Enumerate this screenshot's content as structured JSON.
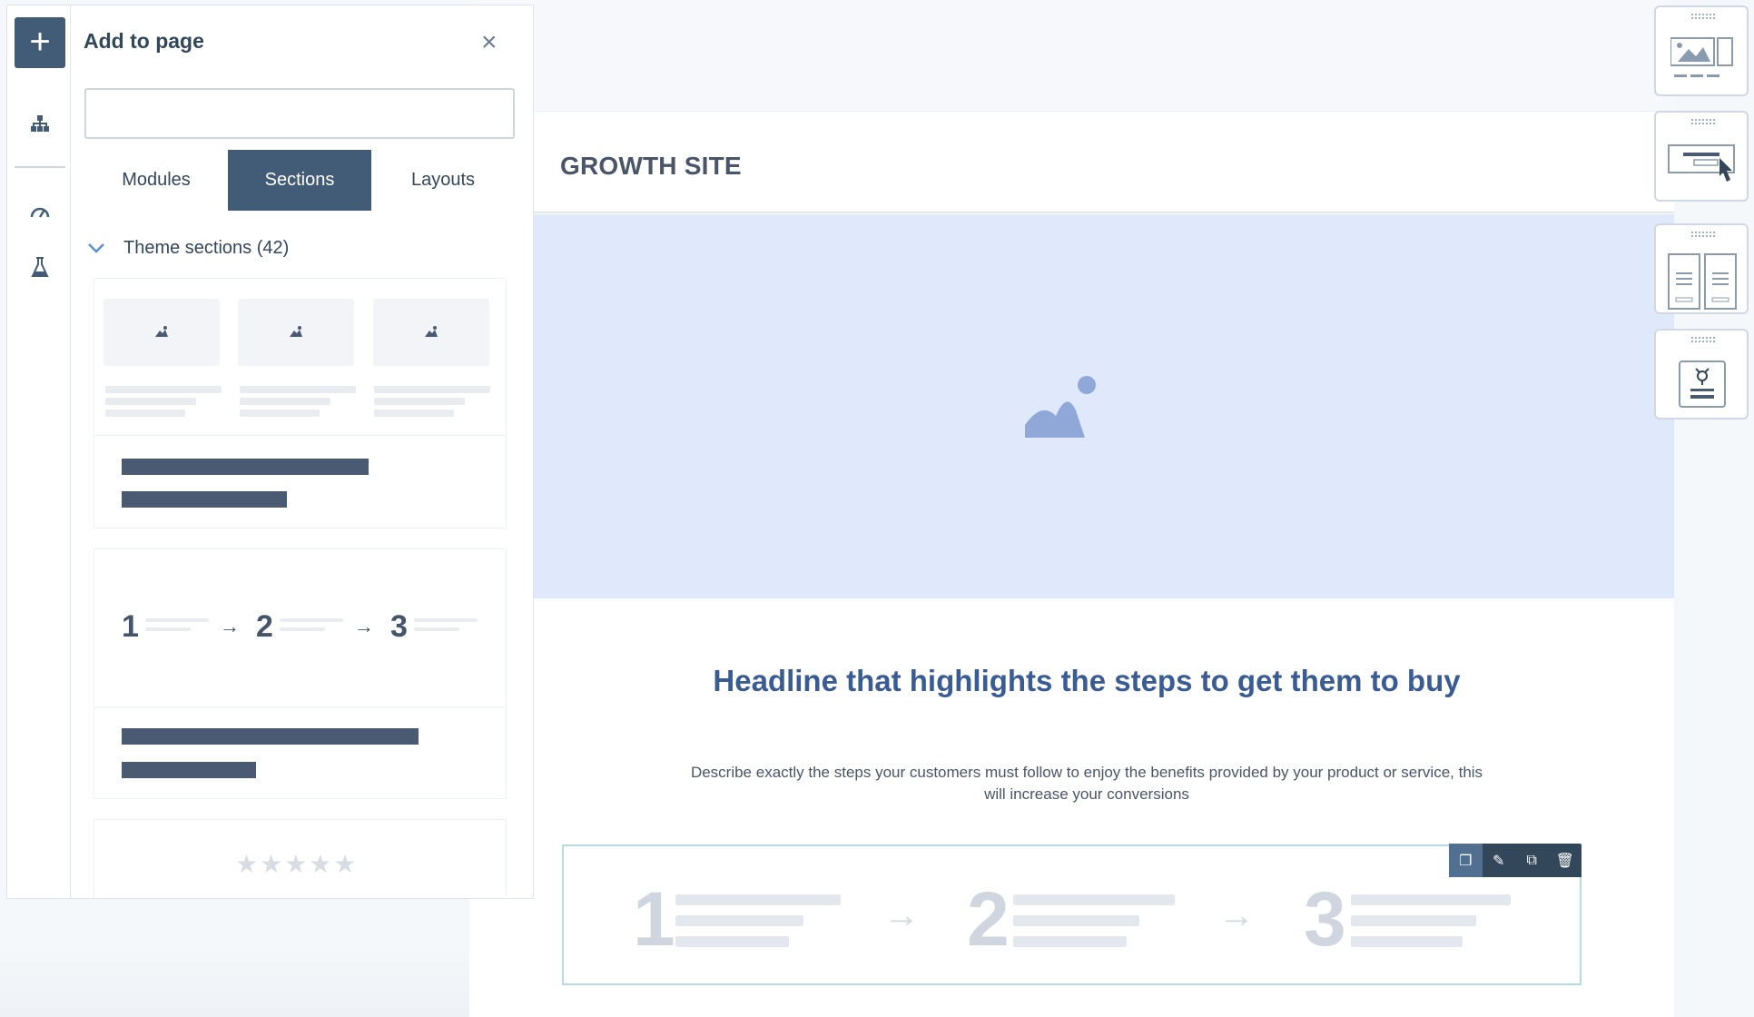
{
  "panel": {
    "title": "Add to page",
    "search_placeholder": "",
    "tabs": [
      {
        "label": "Modules"
      },
      {
        "label": "Sections"
      },
      {
        "label": "Layouts"
      }
    ],
    "section_header": "Theme sections (42)",
    "card_steps": {
      "n1": "1",
      "n2": "2",
      "n3": "3"
    }
  },
  "canvas": {
    "site_title": "GROWTH SITE",
    "headline": "Headline that highlights the steps to get them to buy",
    "description": "Describe exactly the steps your customers must follow to enjoy the benefits provided by your product or service, this will increase your conversions",
    "steps": {
      "n1": "1",
      "n2": "2",
      "n3": "3"
    }
  },
  "colors": {
    "accent": "#425b76",
    "headline": "#3a5c95",
    "hero_bg": "#e0e9fb"
  }
}
